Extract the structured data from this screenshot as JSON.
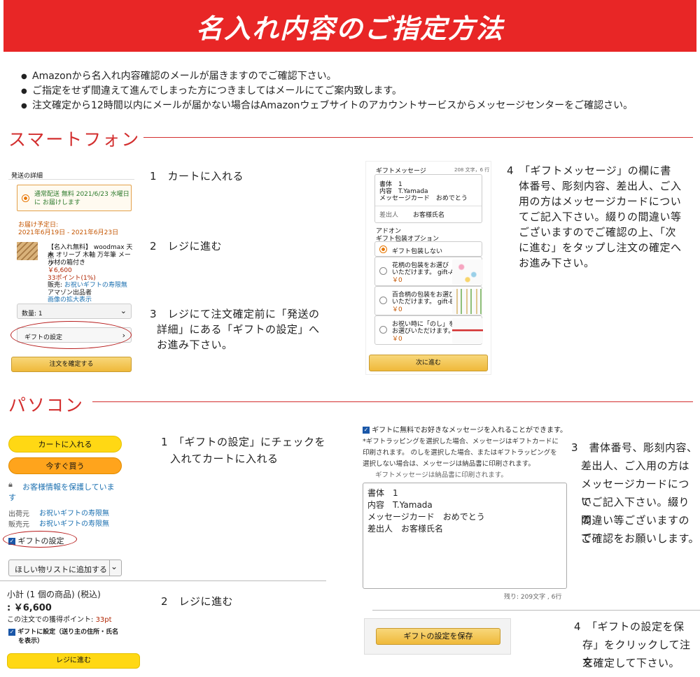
{
  "header": {
    "title": "名入れ内容のご指定方法"
  },
  "notes": [
    "Amazonから名入れ内容確認のメールが届きますのでご確認下さい。",
    "ご指定をせず間違えて進んでしまった方につきましてはメールにてご案内致します。",
    "注文確定から12時間以内にメールが届かない場合はAmazonウェブサイトのアカウントサービスからメッセージセンターをご確認さい。"
  ],
  "smartphone": {
    "title": "スマートフォン",
    "steps": {
      "s1": "1　カートに入れる",
      "s2": "2　レジに進む",
      "s3_line1": "3　レジにて注文確定前に「発送の",
      "s3_line2": "詳細」にある「ギフトの設定」へ",
      "s3_line3": "お進み下さい。",
      "s4_line1": "4　「ギフトメッセージ」の欄に書",
      "s4_line2": "体番号、彫刻内容、差出人、ご入",
      "s4_line3": "用の方はメッセージカードについ",
      "s4_line4": "てご記入下さい。綴りの間違い等",
      "s4_line5": "ございますのでご確認の上、「次",
      "s4_line6": "に進む」をタップし注文の確定へ",
      "s4_line7": "お進み下さい。"
    },
    "shipping": {
      "heading": "発送の詳細",
      "option_line1": "通常配送 無料 2021/6/23 水曜日",
      "option_line2": "に お届けします",
      "eta_label": "お届け予定日:",
      "eta_range": "2021年6月19日 - 2021年6月23日",
      "product_line1": "【名入れ無料】 woodmax 天然",
      "product_line2": "木 オリーブ 木軸 万年筆 メープ",
      "product_line3": "ル材の箱付き",
      "price": "￥6,600",
      "points": "33ポイント(1%)",
      "seller_label": "販売:",
      "seller": "お祝いギフトの寿限無",
      "shipper": "アマゾン出品者",
      "zoom": "画像の拡大表示",
      "qty": "数量: 1",
      "gift_settings": "ギフトの設定",
      "confirm": "注文を確定する"
    },
    "gift_message": {
      "heading": "ギフトメッセージ",
      "remaining": "208 文字，6 行",
      "line1": "書体　1",
      "line2": "内容　T.Yamada",
      "line3": "メッセージカード　おめでとう",
      "sender_label": "差出人",
      "sender": "お客様氏名",
      "addon": "アドオン",
      "wrap_heading": "ギフト包装オプション",
      "opt0": "ギフト包装しない",
      "opt1_line1": "花柄の包装をお選び",
      "opt1_line2": "いただけます。 gift-A",
      "opt2_line1": "百合柄の包装をお選び",
      "opt2_line2": "いただけます。 gift-B",
      "opt3_line1": "お祝い時に「のし」を",
      "opt3_line2": "お選びいただけます。",
      "zero": "￥0",
      "next": "次に進む"
    }
  },
  "pc": {
    "title": "パソコン",
    "steps": {
      "p1_line1": "1　「ギフトの設定」にチェックを",
      "p1_line2": "入れてカートに入れる",
      "p2": "2　レジに進む",
      "p3_line1": "3　書体番号、彫刻内容、",
      "p3_line2": "差出人、ご入用の方は",
      "p3_line3": "メッセージカードについ",
      "p3_line4": "てご記入下さい。綴りの",
      "p3_line5": "間違い等ございますので",
      "p3_line6": "ご確認をお願いします。",
      "p4_line1": "4　「ギフトの設定を保",
      "p4_line2": "存」をクリックして注文",
      "p4_line3": "を確定して下さい。"
    },
    "buybox": {
      "add_to_cart": "カートに入れる",
      "buy_now": "今すぐ買う",
      "secure_line1": "お客様情報を保護していま",
      "secure_line2": "す",
      "ship_from_label": "出荷元",
      "ship_from": "お祝いギフトの寿限無",
      "sold_by_label": "販売元",
      "sold_by": "お祝いギフトの寿限無",
      "gift_option": "ギフトの設定",
      "wishlist": "ほしい物リストに追加する"
    },
    "checkout": {
      "subtotal": "小計 (1 個の商品) (税込)",
      "price": ": ￥6,600",
      "points_label": "この注文での獲得ポイント:",
      "points": "33pt",
      "gift_line1": "ギフトに設定（送り主の住所・氏名",
      "gift_line2": "を表示）",
      "proceed": "レジに進む"
    },
    "message": {
      "check_label": "ギフトに無料でお好きなメッセージを入れることができます。",
      "note_line1": "*ギフトラッピングを選択した場合、メッセージはギフトカードに",
      "note_line2": "印刷されます。 のしを選択した場合、またはギフトラッピングを",
      "note_line3": "選択しない場合は、メッセージは納品書に印刷されます。",
      "note_line4": "ギフトメッセージは納品書に印刷されます。",
      "line1": "書体　1",
      "line2": "内容　T.Yamada",
      "line3": "メッセージカード　おめでとう",
      "line4": "差出人　お客様氏名",
      "remaining": "残り: 209文字 , 6行",
      "save": "ギフトの設定を保存"
    }
  }
}
